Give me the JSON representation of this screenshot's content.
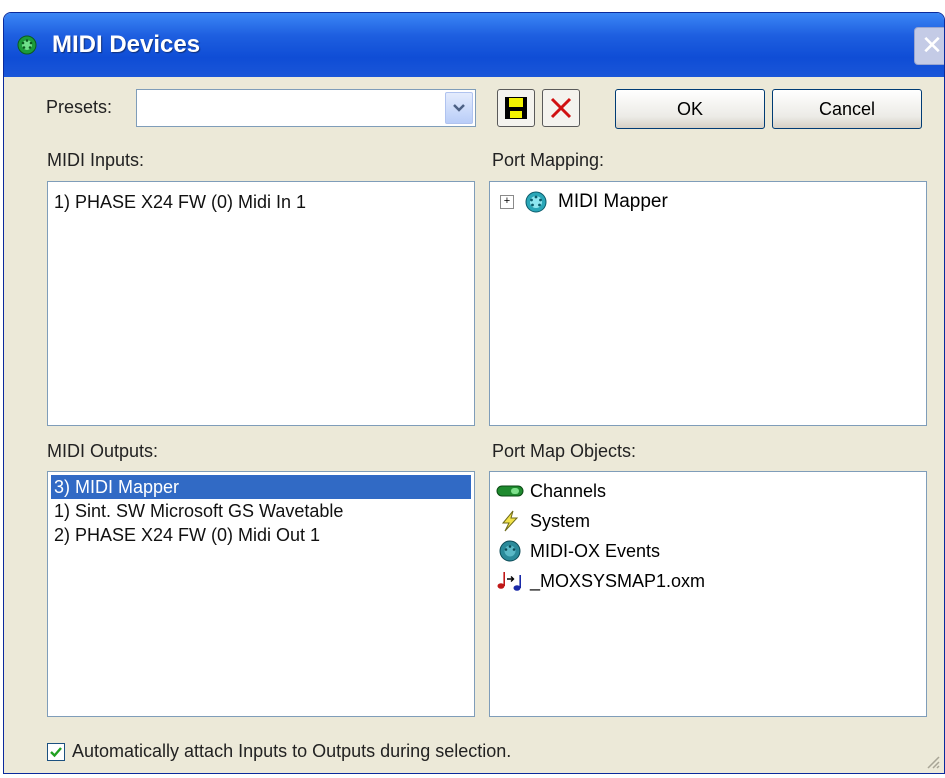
{
  "window": {
    "title": "MIDI Devices",
    "close_glyph": "✕",
    "title_icon": "midi-port-icon",
    "accent": "#0f4dd6"
  },
  "presets": {
    "label": "Presets:",
    "value": ""
  },
  "toolbar": {
    "save_icon": "floppy-disk-icon",
    "delete_icon": "red-x-icon",
    "ok_label": "OK",
    "cancel_label": "Cancel"
  },
  "midi_inputs": {
    "label": "MIDI Inputs:",
    "items": [
      "1) PHASE X24 FW (0) Midi In 1"
    ]
  },
  "port_mapping": {
    "label": "Port Mapping:",
    "root": "MIDI Mapper",
    "expander": "+"
  },
  "midi_outputs": {
    "label": "MIDI Outputs:",
    "items": [
      "3) MIDI Mapper",
      "1) Sint. SW Microsoft GS Wavetable",
      "2) PHASE X24 FW (0) Midi Out 1"
    ],
    "selected_index": 0
  },
  "port_map_objects": {
    "label": "Port Map Objects:",
    "items": [
      {
        "label": "Channels",
        "icon": "channels-icon"
      },
      {
        "label": "System",
        "icon": "lightning-icon"
      },
      {
        "label": "MIDI-OX Events",
        "icon": "midi-port-icon"
      },
      {
        "label": "_MOXSYSMAP1.oxm",
        "icon": "music-notes-icon"
      }
    ]
  },
  "auto_attach": {
    "label": "Automatically attach Inputs to Outputs during selection.",
    "checked": true
  }
}
